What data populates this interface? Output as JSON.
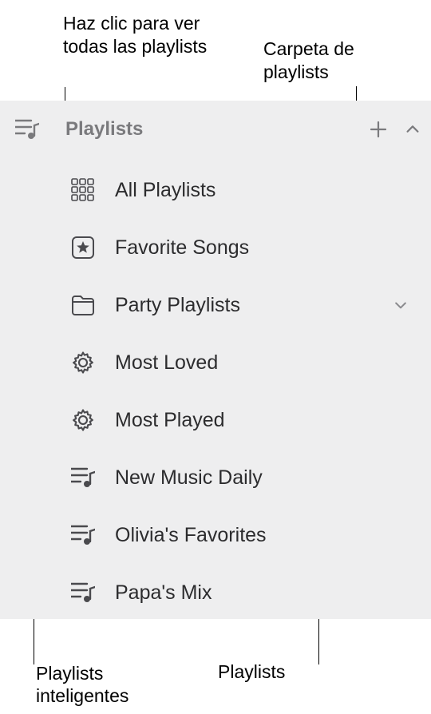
{
  "callouts": {
    "all_playlists_hint": "Haz clic para ver todas las playlists",
    "folder_hint": "Carpeta de playlists",
    "smart_hint": "Playlists inteligentes",
    "playlists_hint": "Playlists"
  },
  "sidebar": {
    "header": "Playlists",
    "items": [
      {
        "label": "All Playlists"
      },
      {
        "label": "Favorite Songs"
      },
      {
        "label": "Party Playlists"
      },
      {
        "label": "Most Loved"
      },
      {
        "label": "Most Played"
      },
      {
        "label": "New Music Daily"
      },
      {
        "label": "Olivia's Favorites"
      },
      {
        "label": "Papa's Mix"
      }
    ]
  }
}
